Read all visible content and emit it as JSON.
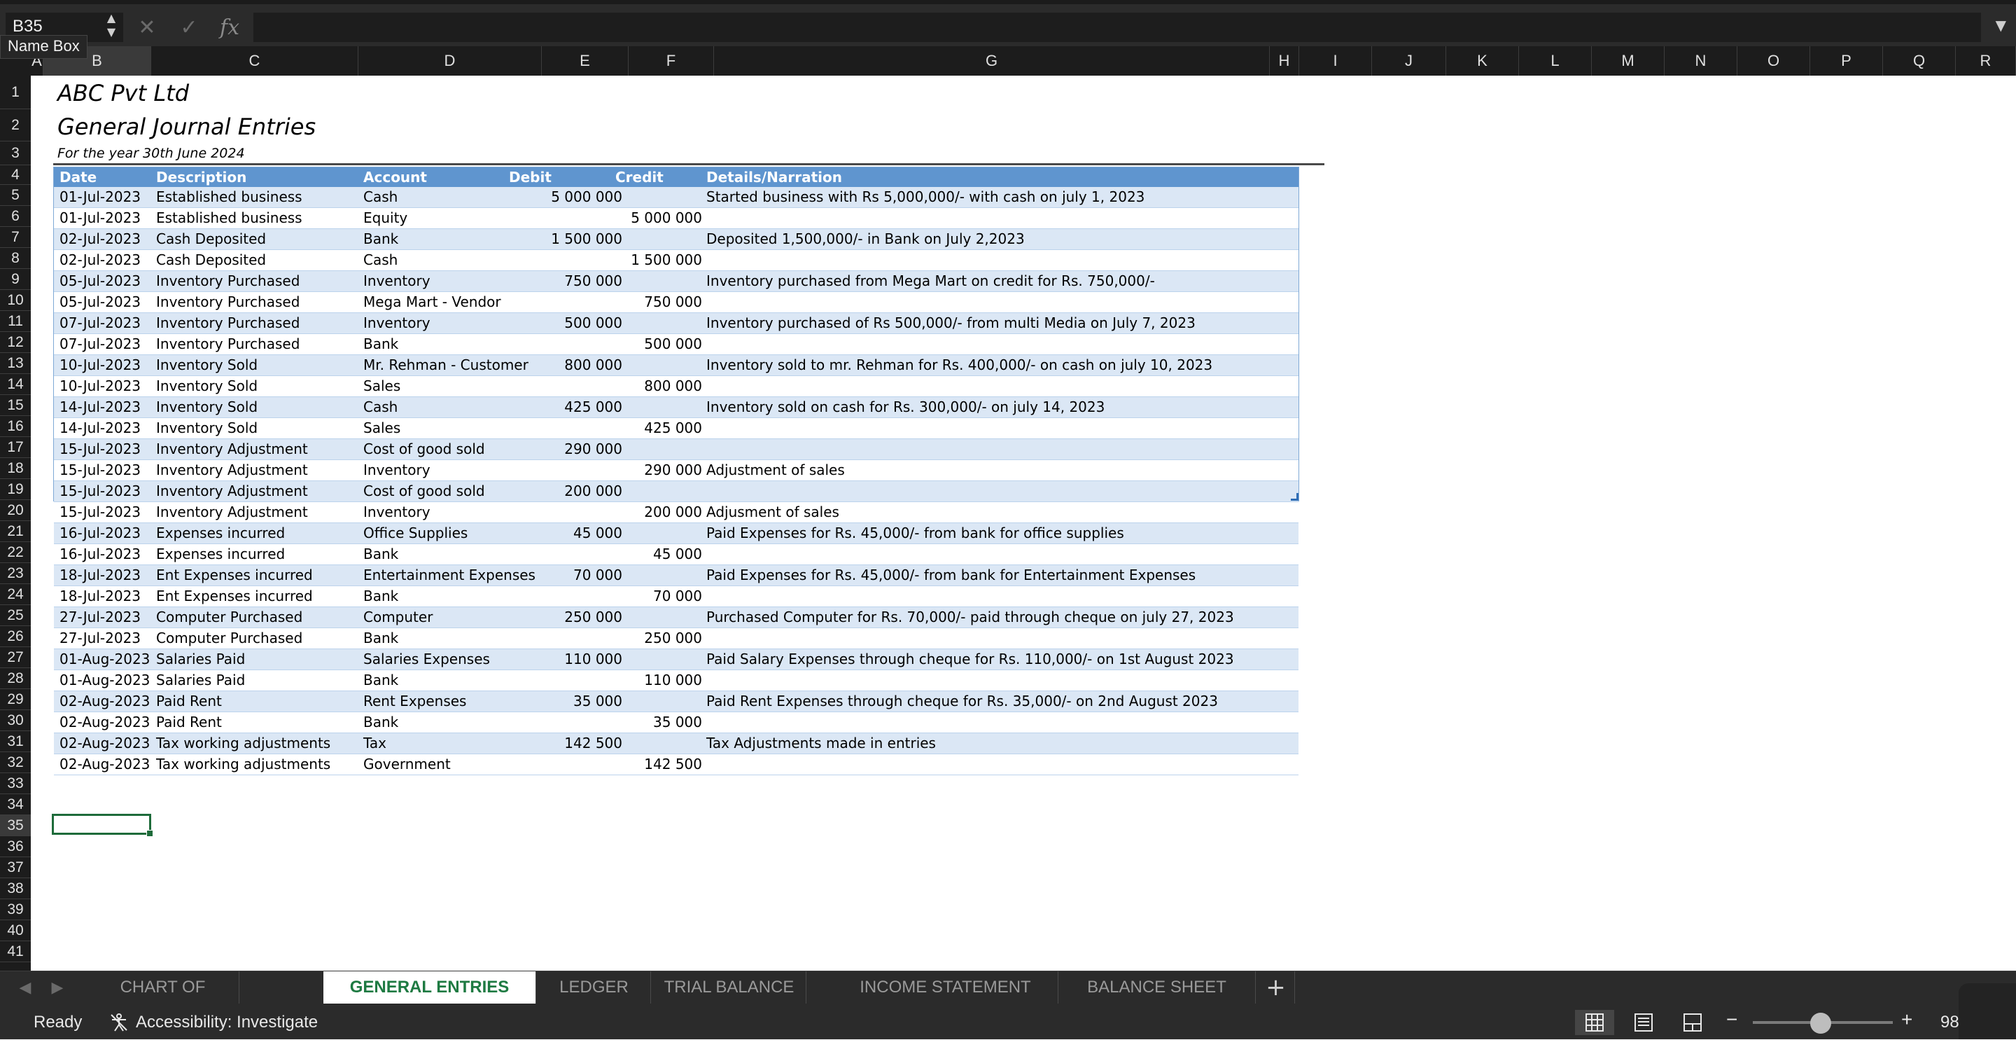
{
  "name_box": {
    "value": "B35",
    "tooltip": "Name Box"
  },
  "formula_bar": {
    "fx_label": "fx",
    "cancel_glyph": "✕",
    "confirm_glyph": "✓"
  },
  "columns": [
    "A",
    "B",
    "C",
    "D",
    "E",
    "F",
    "G",
    "H",
    "I",
    "J",
    "K",
    "L",
    "M",
    "N",
    "O",
    "P",
    "Q",
    "R"
  ],
  "rows": [
    "1",
    "2",
    "3",
    "4",
    "5",
    "6",
    "7",
    "8",
    "9",
    "10",
    "11",
    "12",
    "13",
    "14",
    "15",
    "16",
    "17",
    "18",
    "19",
    "20",
    "21",
    "22",
    "23",
    "24",
    "25",
    "26",
    "27",
    "28",
    "29",
    "30",
    "31",
    "32",
    "33",
    "34",
    "35",
    "36",
    "37",
    "38",
    "39",
    "40",
    "41"
  ],
  "sheet": {
    "company": "ABC Pvt Ltd",
    "title": "General Journal Entries",
    "subtitle": "For the year 30th June 2024",
    "headers": [
      "Date",
      "Description",
      "Account",
      "Debit",
      "Credit",
      "Details/Narration"
    ],
    "entries": [
      [
        "01-Jul-2023",
        "Established business",
        "Cash",
        "5 000 000",
        "",
        "Started business with Rs 5,000,000/- with cash on july 1, 2023"
      ],
      [
        "01-Jul-2023",
        "Established business",
        "Equity",
        "",
        "5 000 000",
        ""
      ],
      [
        "02-Jul-2023",
        "Cash Deposited",
        "Bank",
        "1 500 000",
        "",
        "Deposited 1,500,000/- in Bank on July 2,2023"
      ],
      [
        "02-Jul-2023",
        "Cash Deposited",
        "Cash",
        "",
        "1 500 000",
        ""
      ],
      [
        "05-Jul-2023",
        "Inventory Purchased",
        "Inventory",
        "750 000",
        "",
        "Inventory purchased from Mega Mart on credit for Rs. 750,000/-"
      ],
      [
        "05-Jul-2023",
        "Inventory Purchased",
        "Mega Mart - Vendor",
        "",
        "750 000",
        ""
      ],
      [
        "07-Jul-2023",
        "Inventory Purchased",
        "Inventory",
        "500 000",
        "",
        "Inventory purchased of Rs 500,000/- from multi Media on July 7, 2023"
      ],
      [
        "07-Jul-2023",
        "Inventory Purchased",
        "Bank",
        "",
        "500 000",
        ""
      ],
      [
        "10-Jul-2023",
        "Inventory Sold",
        "Mr. Rehman - Customer",
        "800 000",
        "",
        "Inventory sold to mr. Rehman for Rs. 400,000/- on cash on july 10, 2023"
      ],
      [
        "10-Jul-2023",
        "Inventory Sold",
        "Sales",
        "",
        "800 000",
        ""
      ],
      [
        "14-Jul-2023",
        "Inventory Sold",
        "Cash",
        "425 000",
        "",
        "Inventory sold on cash for Rs. 300,000/- on july 14, 2023"
      ],
      [
        "14-Jul-2023",
        "Inventory Sold",
        "Sales",
        "",
        "425 000",
        ""
      ],
      [
        "15-Jul-2023",
        "Inventory Adjustment",
        "Cost of good sold",
        "290 000",
        "",
        ""
      ],
      [
        "15-Jul-2023",
        "Inventory Adjustment",
        "Inventory",
        "",
        "290 000",
        "Adjustment of sales"
      ],
      [
        "15-Jul-2023",
        "Inventory Adjustment",
        "Cost of good sold",
        "200 000",
        "",
        ""
      ],
      [
        "15-Jul-2023",
        "Inventory Adjustment",
        "Inventory",
        "",
        "200 000",
        "Adjusment of sales"
      ],
      [
        "16-Jul-2023",
        "Expenses incurred",
        "Office Supplies",
        "45 000",
        "",
        "Paid Expenses for Rs. 45,000/- from bank for office supplies"
      ],
      [
        "16-Jul-2023",
        "Expenses incurred",
        "Bank",
        "",
        "45 000",
        ""
      ],
      [
        "18-Jul-2023",
        "Ent Expenses incurred",
        "Entertainment Expenses",
        "70 000",
        "",
        "Paid Expenses for Rs. 45,000/- from bank for Entertainment Expenses"
      ],
      [
        "18-Jul-2023",
        "Ent Expenses incurred",
        "Bank",
        "",
        "70 000",
        ""
      ],
      [
        "27-Jul-2023",
        "Computer Purchased",
        "Computer",
        "250 000",
        "",
        "Purchased Computer for Rs. 70,000/- paid through cheque on july 27, 2023"
      ],
      [
        "27-Jul-2023",
        "Computer Purchased",
        "Bank",
        "",
        "250 000",
        ""
      ],
      [
        "01-Aug-2023",
        "Salaries Paid",
        "Salaries Expenses",
        "110 000",
        "",
        "Paid Salary Expenses through cheque for Rs. 110,000/- on 1st August 2023"
      ],
      [
        "01-Aug-2023",
        "Salaries Paid",
        "Bank",
        "",
        "110 000",
        ""
      ],
      [
        "02-Aug-2023",
        "Paid Rent",
        "Rent Expenses",
        "35 000",
        "",
        "Paid Rent Expenses through cheque for Rs. 35,000/- on 2nd August 2023"
      ],
      [
        "02-Aug-2023",
        "Paid Rent",
        "Bank",
        "",
        "35 000",
        ""
      ],
      [
        "02-Aug-2023",
        "Tax working adjustments",
        "Tax",
        "142 500",
        "",
        "Tax Adjustments made in entries"
      ],
      [
        "02-Aug-2023",
        "Tax working adjustments",
        "Government",
        "",
        "142 500",
        ""
      ]
    ]
  },
  "tabs": [
    {
      "label": "CHART OF ACCOUNTS",
      "active": false
    },
    {
      "label": "GENERAL ENTRIES",
      "active": true
    },
    {
      "label": "LEDGER",
      "active": false
    },
    {
      "label": "TRIAL BALANCE",
      "active": false
    },
    {
      "label": "INCOME STATEMENT",
      "active": false
    },
    {
      "label": "BALANCE SHEET",
      "active": false
    }
  ],
  "add_sheet_label": "+",
  "status": {
    "ready": "Ready",
    "accessibility": "Accessibility: Investigate",
    "zoom": "98",
    "zoom_minus": "−",
    "zoom_plus": "+"
  },
  "icons": {
    "accessibility": "accessibility-icon",
    "normal_view": "grid-view-icon",
    "page_layout": "page-layout-icon",
    "page_break": "page-break-icon"
  },
  "colors": {
    "header_blue": "#5f95cf",
    "band_blue": "#dbe7f5",
    "active_tab_green": "#1e7a42",
    "selection_green": "#1e6b3a"
  }
}
